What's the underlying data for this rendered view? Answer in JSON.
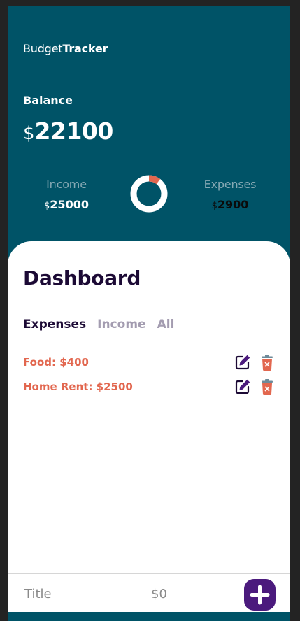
{
  "brand": {
    "light": "Budget",
    "bold": "Tracker"
  },
  "balance": {
    "label": "Balance",
    "currency": "$",
    "amount": "22100"
  },
  "income": {
    "label": "Income",
    "currency": "$",
    "amount": "25000"
  },
  "expenses": {
    "label": "Expenses",
    "currency": "$",
    "amount": "2900"
  },
  "donut": {
    "income_share": 0.896,
    "expenses_share": 0.104,
    "income_color": "#ffffff",
    "expenses_color": "#e2674f"
  },
  "dashboard": {
    "title": "Dashboard",
    "tabs": [
      {
        "label": "Expenses",
        "active": true
      },
      {
        "label": "Income",
        "active": false
      },
      {
        "label": "All",
        "active": false
      }
    ],
    "items": [
      {
        "text": "Food: $400",
        "edit_icon": "edit-icon",
        "delete_icon": "trash-icon"
      },
      {
        "text": "Home Rent: $2500",
        "edit_icon": "edit-icon",
        "delete_icon": "trash-icon"
      }
    ]
  },
  "form": {
    "title_placeholder": "Title",
    "amount_placeholder": "$0",
    "add_icon": "plus-icon"
  },
  "colors": {
    "header_bg": "#005367",
    "accent_red": "#e2674f",
    "accent_purple": "#4b1a7d",
    "title_dark": "#1c0a35"
  }
}
